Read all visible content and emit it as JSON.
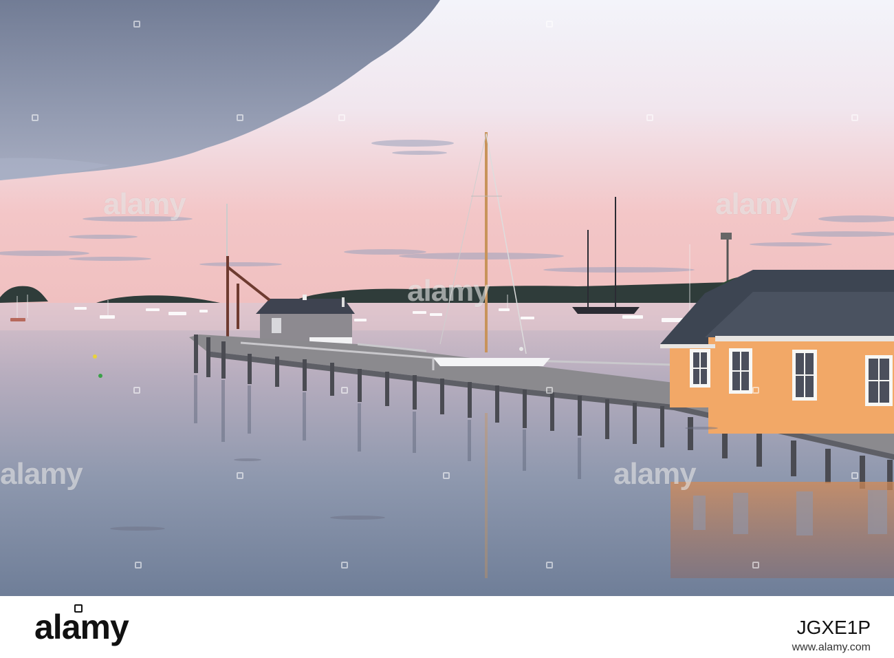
{
  "photo": {
    "scene": "harbor-at-sunset",
    "colors": {
      "sky_top": "#eef2f8",
      "sky_pink": "#f2c3c4",
      "water": "#8f9ab0",
      "building": "#f2a867",
      "roof": "#3d4552"
    }
  },
  "watermark": {
    "text": "alamy"
  },
  "footer": {
    "logo": "alamy",
    "image_id": "JGXE1P",
    "url": "www.alamy.com"
  }
}
